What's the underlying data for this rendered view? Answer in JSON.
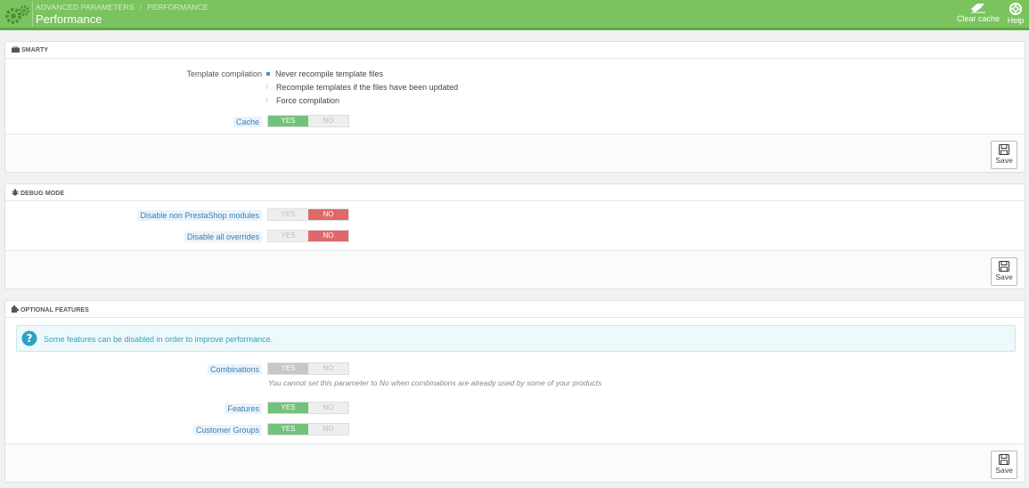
{
  "header": {
    "breadcrumb": [
      "ADVANCED PARAMETERS",
      "PERFORMANCE"
    ],
    "breadcrumb_sep": "/",
    "title": "Performance",
    "toolbar": {
      "clear_cache": "Clear cache",
      "help": "Help"
    },
    "accent": "#7ac35f"
  },
  "smarty": {
    "heading": "SMARTY",
    "template_label": "Template compilation",
    "options": [
      "Never recompile template files",
      "Recompile templates if the files have been updated",
      "Force compilation"
    ],
    "selected_option": 0,
    "cache_label": "Cache",
    "cache": {
      "yes": "YES",
      "no": "NO",
      "value": "YES"
    },
    "save": "Save"
  },
  "debug": {
    "heading": "DEBUG MODE",
    "disable_modules_label": "Disable non PrestaShop modules",
    "disable_modules": {
      "yes": "YES",
      "no": "NO",
      "value": "NO"
    },
    "disable_overrides_label": "Disable all overrides",
    "disable_overrides": {
      "yes": "YES",
      "no": "NO",
      "value": "NO"
    },
    "save": "Save"
  },
  "optional": {
    "heading": "OPTIONAL FEATURES",
    "alert": "Some features can be disabled in order to improve performance.",
    "combinations_label": "Combinations",
    "combinations": {
      "yes": "YES",
      "no": "NO",
      "value": "YES",
      "disabled": true
    },
    "combinations_help": "You cannot set this parameter to No when combinations are already used by some of your products",
    "features_label": "Features",
    "features": {
      "yes": "YES",
      "no": "NO",
      "value": "YES"
    },
    "groups_label": "Customer Groups",
    "groups": {
      "yes": "YES",
      "no": "NO",
      "value": "YES"
    },
    "save": "Save"
  },
  "colors": {
    "green": "#72c279",
    "red": "#e0686a",
    "info": "#2fa2c3"
  }
}
